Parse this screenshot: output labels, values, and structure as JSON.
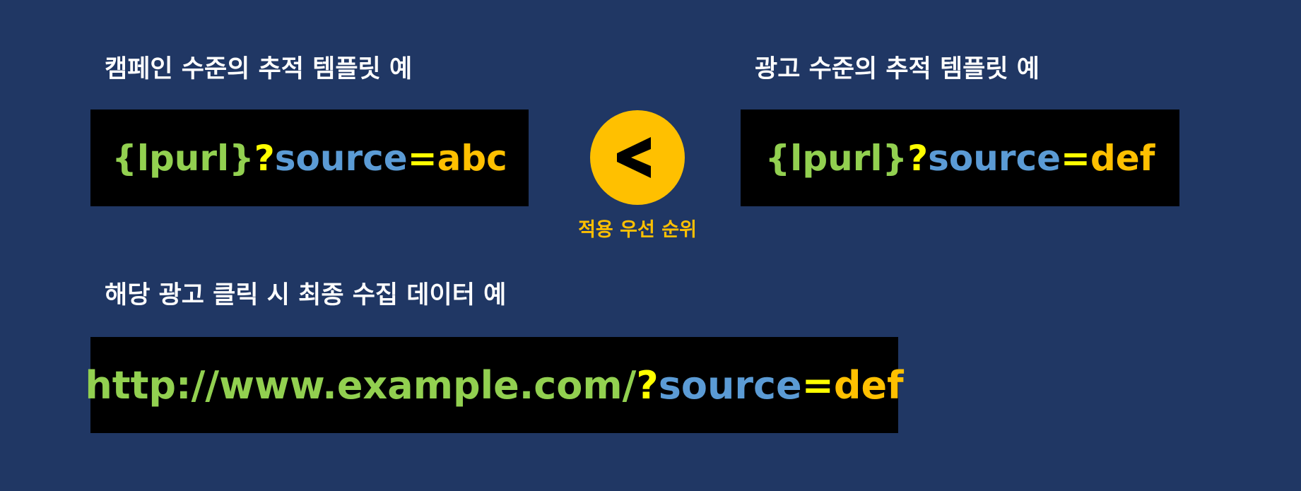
{
  "colors": {
    "background": "#203764",
    "box": "#000000",
    "label": "#ffffff",
    "part_green": "#92d050",
    "part_yellow": "#ffff00",
    "part_blue": "#5b9bd5",
    "part_orange": "#ffc000",
    "priority": "#ffc000"
  },
  "campaign": {
    "title": "캠페인 수준의 추적 템플릿 예",
    "template": {
      "part1": "{lpurl}",
      "part2": "?",
      "part3": "source",
      "part4": "=",
      "part5": "abc"
    }
  },
  "ad": {
    "title": "광고 수준의 추적 템플릿 예",
    "template": {
      "part1": "{lpurl}",
      "part2": "?",
      "part3": "source",
      "part4": "=",
      "part5": "def"
    }
  },
  "priority": {
    "symbol": "<",
    "icon": "less-than-icon",
    "caption": "적용 우선 순위"
  },
  "final": {
    "title": "해당 광고 클릭 시 최종 수집 데이터 예",
    "url": {
      "part1": "http://www.example.com/",
      "part2": "?",
      "part3": "source",
      "part4": "=",
      "part5": "def"
    }
  }
}
